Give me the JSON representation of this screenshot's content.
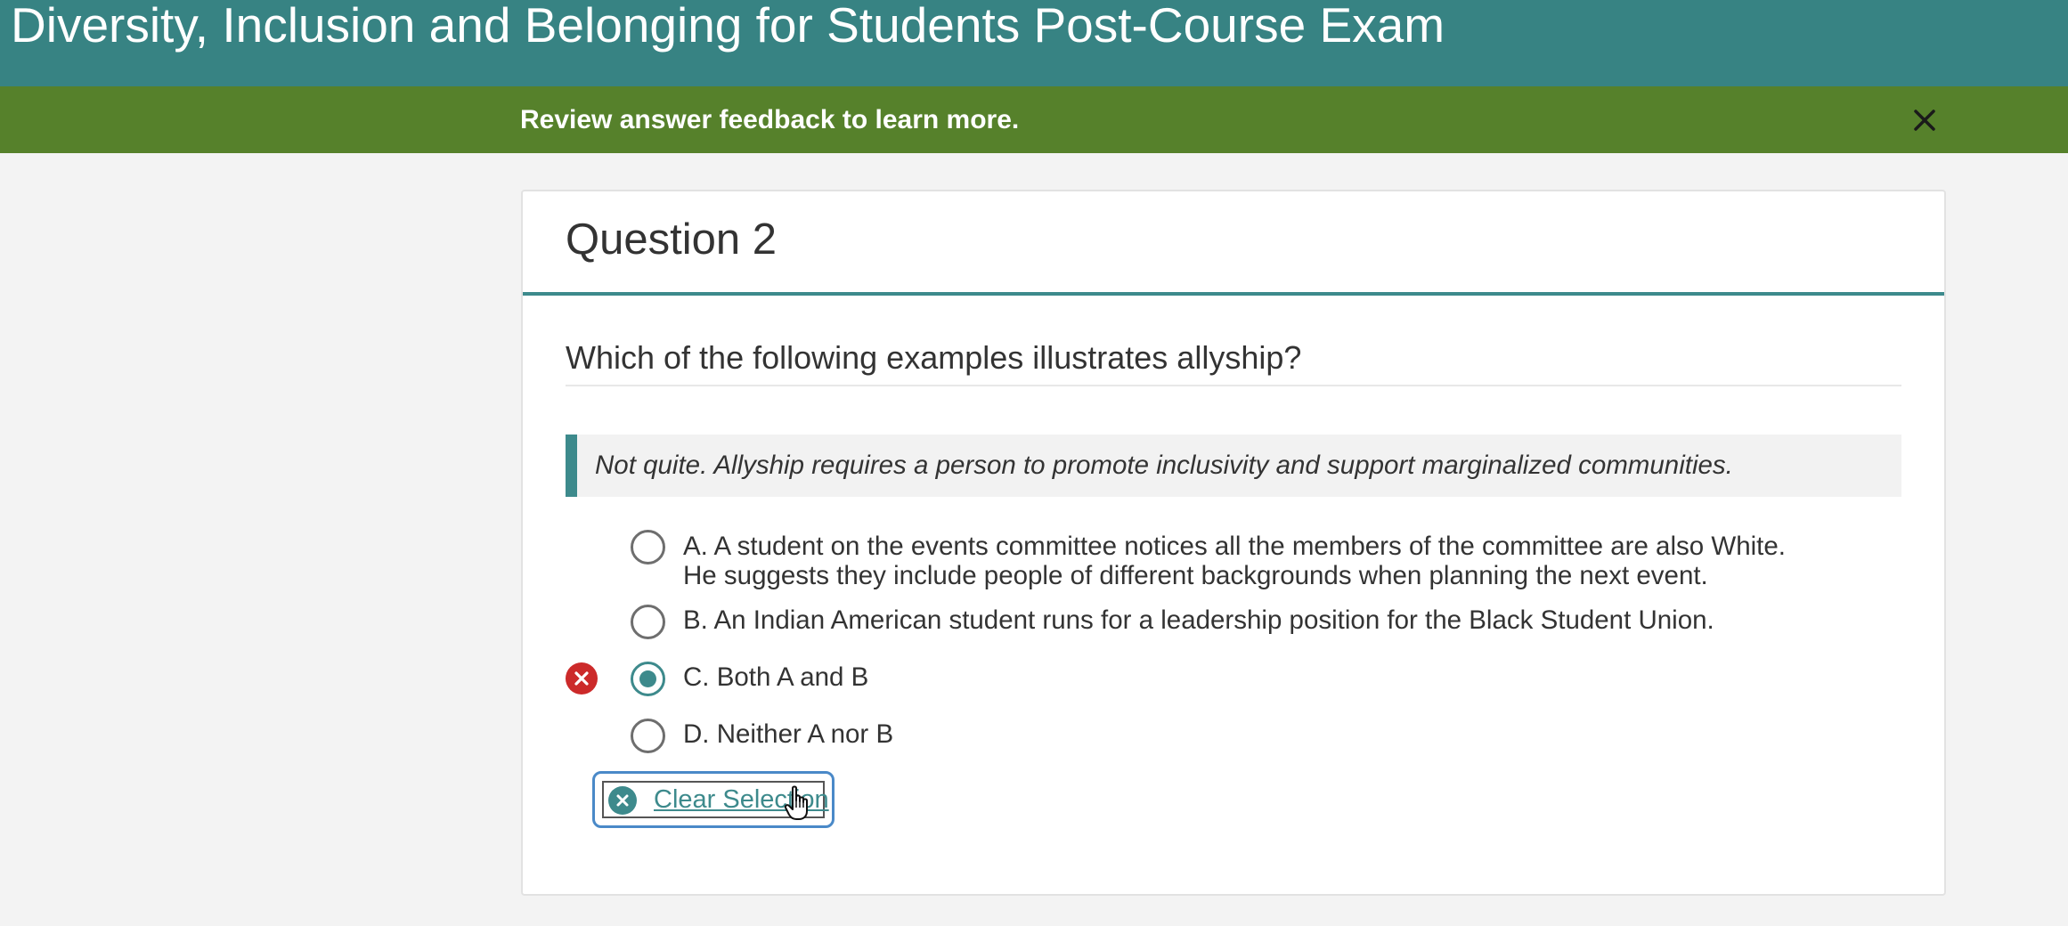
{
  "header": {
    "title": "Diversity, Inclusion and Belonging for Students Post-Course Exam"
  },
  "banner": {
    "message": "Review answer feedback to learn more.",
    "close_icon": "close-icon"
  },
  "question": {
    "title": "Question 2",
    "prompt": "Which of the following examples illustrates allyship?",
    "feedback": "Not quite. Allyship requires a person to promote inclusivity and support marginalized communities.",
    "options": [
      {
        "line1": "A. A student on the events committee notices all the members of the committee are also White.",
        "line2": "He suggests they include people of different backgrounds when planning the next event.",
        "selected": false
      },
      {
        "line1": "B. An Indian American student runs for a leadership position for the Black Student Union.",
        "selected": false
      },
      {
        "line1": "C. Both A and B",
        "selected": true,
        "status": "incorrect",
        "status_icon": "incorrect-x-icon"
      },
      {
        "line1": "D. Neither A nor B",
        "selected": false
      }
    ],
    "clear_button": {
      "label": "Clear Selection",
      "icon": "clear-x-icon"
    }
  },
  "colors": {
    "header_bg": "#378383",
    "banner_bg": "#56812b",
    "accent": "#3d8a8c",
    "incorrect": "#cc2a2a",
    "focus_ring": "#4a89c8"
  }
}
